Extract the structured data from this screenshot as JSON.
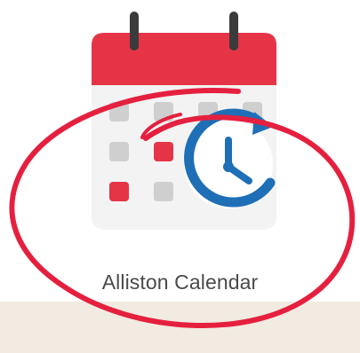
{
  "app": {
    "label": "Alliston Calendar",
    "icon_name": "calendar-clock-icon",
    "highlight": "hand-drawn-circle"
  },
  "colors": {
    "accent_red": "#e63447",
    "clock_blue": "#1f6fb7",
    "grid_gray": "#cfcfcf",
    "calendar_body": "#f3f3f3",
    "text": "#4a4a4a",
    "strip": "#f1ebe2"
  }
}
